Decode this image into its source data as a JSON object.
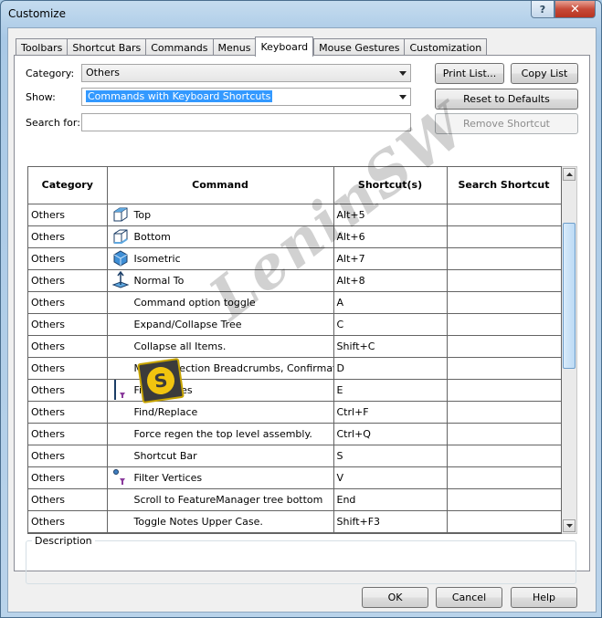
{
  "window": {
    "title": "Customize",
    "help_glyph": "?",
    "close_glyph": "✕"
  },
  "tabs": [
    {
      "label": "Toolbars"
    },
    {
      "label": "Shortcut Bars"
    },
    {
      "label": "Commands"
    },
    {
      "label": "Menus"
    },
    {
      "label": "Keyboard",
      "active": true
    },
    {
      "label": "Mouse Gestures"
    },
    {
      "label": "Customization"
    }
  ],
  "filters": {
    "category_label": "Category:",
    "category_value": "Others",
    "show_label": "Show:",
    "show_value": "Commands with Keyboard Shortcuts",
    "search_label": "Search for:",
    "search_value": ""
  },
  "buttons": {
    "print_list": "Print List...",
    "copy_list": "Copy List",
    "reset_defaults": "Reset to Defaults",
    "remove_shortcut": "Remove Shortcut",
    "ok": "OK",
    "cancel": "Cancel",
    "help": "Help"
  },
  "grid": {
    "columns": [
      "Category",
      "Command",
      "Shortcut(s)",
      "Search Shortcut"
    ],
    "rows": [
      {
        "category": "Others",
        "command": "Top",
        "shortcut": "Alt+5",
        "search": "",
        "icon": "view-top-icon"
      },
      {
        "category": "Others",
        "command": "Bottom",
        "shortcut": "Alt+6",
        "search": "",
        "icon": "view-bottom-icon"
      },
      {
        "category": "Others",
        "command": "Isometric",
        "shortcut": "Alt+7",
        "search": "",
        "icon": "view-isometric-icon"
      },
      {
        "category": "Others",
        "command": "Normal To",
        "shortcut": "Alt+8",
        "search": "",
        "icon": "normal-to-icon"
      },
      {
        "category": "Others",
        "command": "Command option toggle",
        "shortcut": "A",
        "search": "",
        "icon": ""
      },
      {
        "category": "Others",
        "command": "Expand/Collapse Tree",
        "shortcut": "C",
        "search": "",
        "icon": ""
      },
      {
        "category": "Others",
        "command": "Collapse all Items.",
        "shortcut": "Shift+C",
        "search": "",
        "icon": ""
      },
      {
        "category": "Others",
        "command": "Move Selection Breadcrumbs, Confirmatio",
        "shortcut": "D",
        "search": "",
        "icon": ""
      },
      {
        "category": "Others",
        "command": "Filter Edges",
        "shortcut": "E",
        "search": "",
        "icon": "filter-edges-icon"
      },
      {
        "category": "Others",
        "command": "Find/Replace",
        "shortcut": "Ctrl+F",
        "search": "",
        "icon": ""
      },
      {
        "category": "Others",
        "command": "Force regen the top level assembly.",
        "shortcut": "Ctrl+Q",
        "search": "",
        "icon": ""
      },
      {
        "category": "Others",
        "command": "Shortcut Bar",
        "shortcut": "S",
        "search": "",
        "icon": ""
      },
      {
        "category": "Others",
        "command": "Filter Vertices",
        "shortcut": "V",
        "search": "",
        "icon": "filter-vertices-icon"
      },
      {
        "category": "Others",
        "command": "Scroll to FeatureManager tree bottom",
        "shortcut": "End",
        "search": "",
        "icon": ""
      },
      {
        "category": "Others",
        "command": "Toggle Notes Upper Case.",
        "shortcut": "Shift+F3",
        "search": "",
        "icon": ""
      }
    ]
  },
  "description": {
    "label": "Description",
    "text": ""
  },
  "watermark": {
    "text": "LeninSW",
    "logo_letter": "S"
  }
}
